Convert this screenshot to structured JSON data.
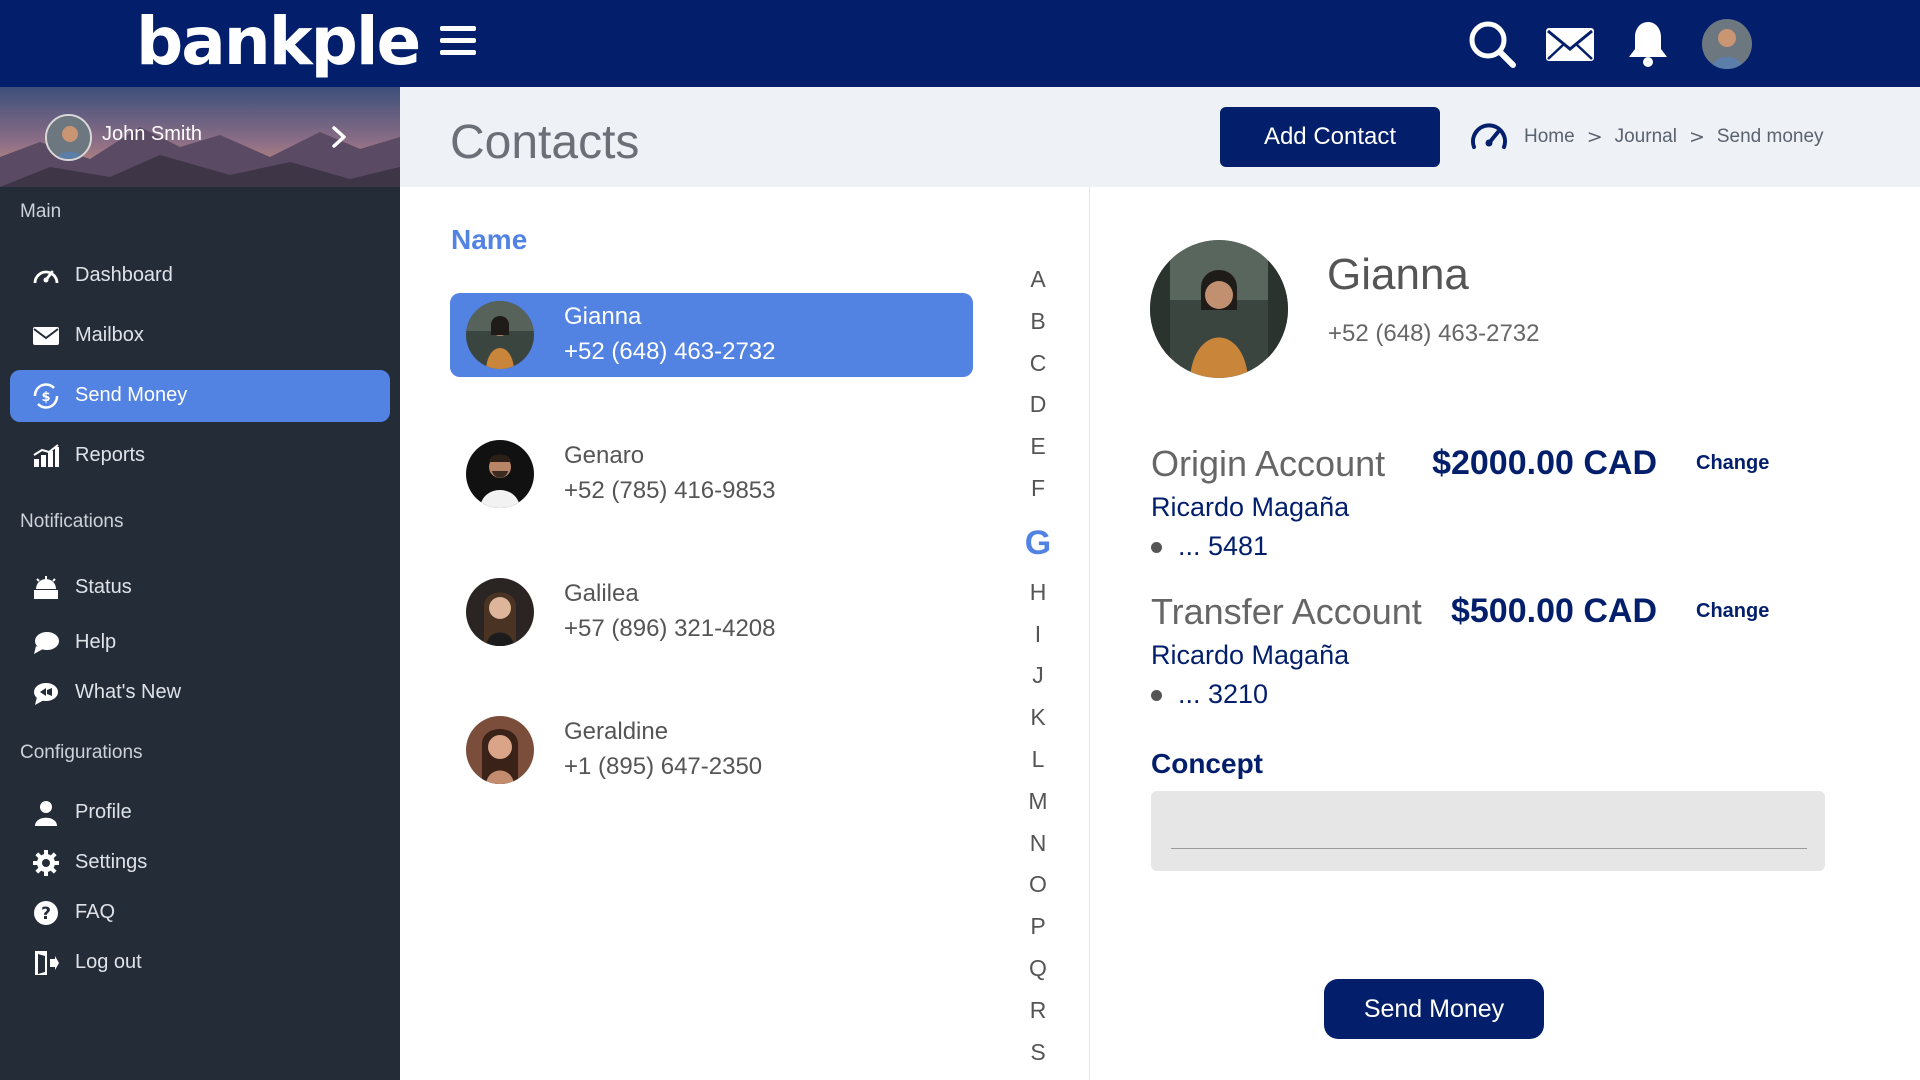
{
  "brand": {
    "logo_text": "bankple",
    "primary_color": "#031f6b",
    "accent_color": "#5282e2",
    "sidebar_color": "#242c38"
  },
  "topbar": {
    "icons": [
      "menu-icon",
      "search-icon",
      "mail-icon",
      "bell-icon",
      "user-avatar"
    ]
  },
  "sidebar": {
    "user_name": "John Smith",
    "sections": [
      {
        "title": "Main",
        "items": [
          {
            "label": "Dashboard",
            "icon": "speedometer-icon"
          },
          {
            "label": "Mailbox",
            "icon": "envelope-icon"
          },
          {
            "label": "Send Money",
            "icon": "money-transfer-icon",
            "active": true
          },
          {
            "label": "Reports",
            "icon": "bar-chart-icon"
          }
        ]
      },
      {
        "title": "Notifications",
        "items": [
          {
            "label": "Status",
            "icon": "status-icon"
          },
          {
            "label": "Help",
            "icon": "chat-bubble-icon"
          },
          {
            "label": "What's New",
            "icon": "megaphone-icon"
          }
        ]
      },
      {
        "title": "Configurations",
        "items": [
          {
            "label": "Profile",
            "icon": "person-icon"
          },
          {
            "label": "Settings",
            "icon": "gear-icon"
          },
          {
            "label": "FAQ",
            "icon": "question-icon"
          },
          {
            "label": "Log out",
            "icon": "logout-icon"
          }
        ]
      }
    ]
  },
  "header": {
    "title": "Contacts",
    "add_contact_label": "Add Contact",
    "breadcrumb": [
      "Home",
      "Journal",
      "Send money"
    ],
    "breadcrumb_separator": ">"
  },
  "contacts": {
    "column_header": "Name",
    "items": [
      {
        "name": "Gianna",
        "phone": "+52 (648) 463-2732",
        "selected": true
      },
      {
        "name": "Genaro",
        "phone": "+52 (785) 416-9853"
      },
      {
        "name": "Galilea",
        "phone": "+57 (896) 321-4208"
      },
      {
        "name": "Geraldine",
        "phone": "+1 (895) 647-2350"
      }
    ],
    "alphabet": [
      "A",
      "B",
      "C",
      "D",
      "E",
      "F",
      "G",
      "H",
      "I",
      "J",
      "K",
      "L",
      "M",
      "N",
      "O",
      "P",
      "Q",
      "R",
      "S"
    ],
    "current_letter": "G"
  },
  "details": {
    "name": "Gianna",
    "phone": "+52 (648) 463-2732",
    "origin": {
      "title": "Origin Account",
      "amount": "$2000.00 CAD",
      "change_label": "Change",
      "owner": "Ricardo Magaña",
      "account": "... 5481"
    },
    "transfer": {
      "title": "Transfer Account",
      "amount": "$500.00 CAD",
      "change_label": "Change",
      "owner": "Ricardo Magaña",
      "account": "... 3210"
    },
    "concept_label": "Concept",
    "concept_value": "",
    "send_label": "Send Money"
  }
}
